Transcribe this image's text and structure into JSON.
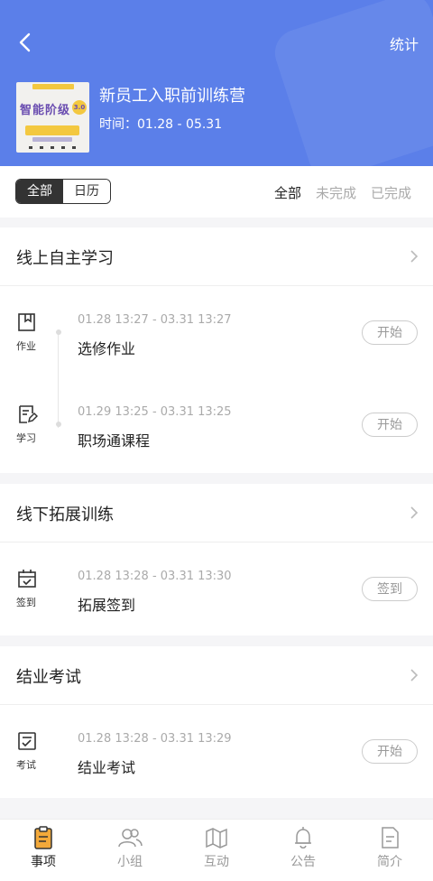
{
  "header": {
    "stats_label": "统计",
    "course_title": "新员工入职前训练营",
    "time_label": "时间：01.28 - 05.31",
    "cover": {
      "title_text": "智能阶级",
      "version": "3.0"
    }
  },
  "filter": {
    "segments": [
      "全部",
      "日历"
    ],
    "status_tabs": [
      "全部",
      "未完成",
      "已完成"
    ]
  },
  "sections": [
    {
      "title": "线上自主学习",
      "tasks": [
        {
          "icon": "bookmark-icon",
          "icon_label": "作业",
          "time": "01.28 13:27 - 03.31 13:27",
          "name": "选修作业",
          "button": "开始"
        },
        {
          "icon": "edit-doc-icon",
          "icon_label": "学习",
          "time": "01.29 13:25 - 03.31 13:25",
          "name": "职场通课程",
          "button": "开始"
        }
      ]
    },
    {
      "title": "线下拓展训练",
      "tasks": [
        {
          "icon": "calendar-check-icon",
          "icon_label": "签到",
          "time": "01.28 13:28 - 03.31 13:30",
          "name": "拓展签到",
          "button": "签到"
        }
      ]
    },
    {
      "title": "结业考试",
      "tasks": [
        {
          "icon": "exam-icon",
          "icon_label": "考试",
          "time": "01.28 13:28 - 03.31 13:29",
          "name": "结业考试",
          "button": "开始"
        }
      ]
    }
  ],
  "tabbar": {
    "items": [
      {
        "label": "事项",
        "icon": "clipboard-icon",
        "active": true
      },
      {
        "label": "小组",
        "icon": "group-icon",
        "active": false
      },
      {
        "label": "互动",
        "icon": "map-icon",
        "active": false
      },
      {
        "label": "公告",
        "icon": "bell-icon",
        "active": false
      },
      {
        "label": "简介",
        "icon": "document-icon",
        "active": false
      }
    ]
  },
  "colors": {
    "header_bg": "#5b7fe9",
    "active_tab_icon": "#f3a93a"
  }
}
